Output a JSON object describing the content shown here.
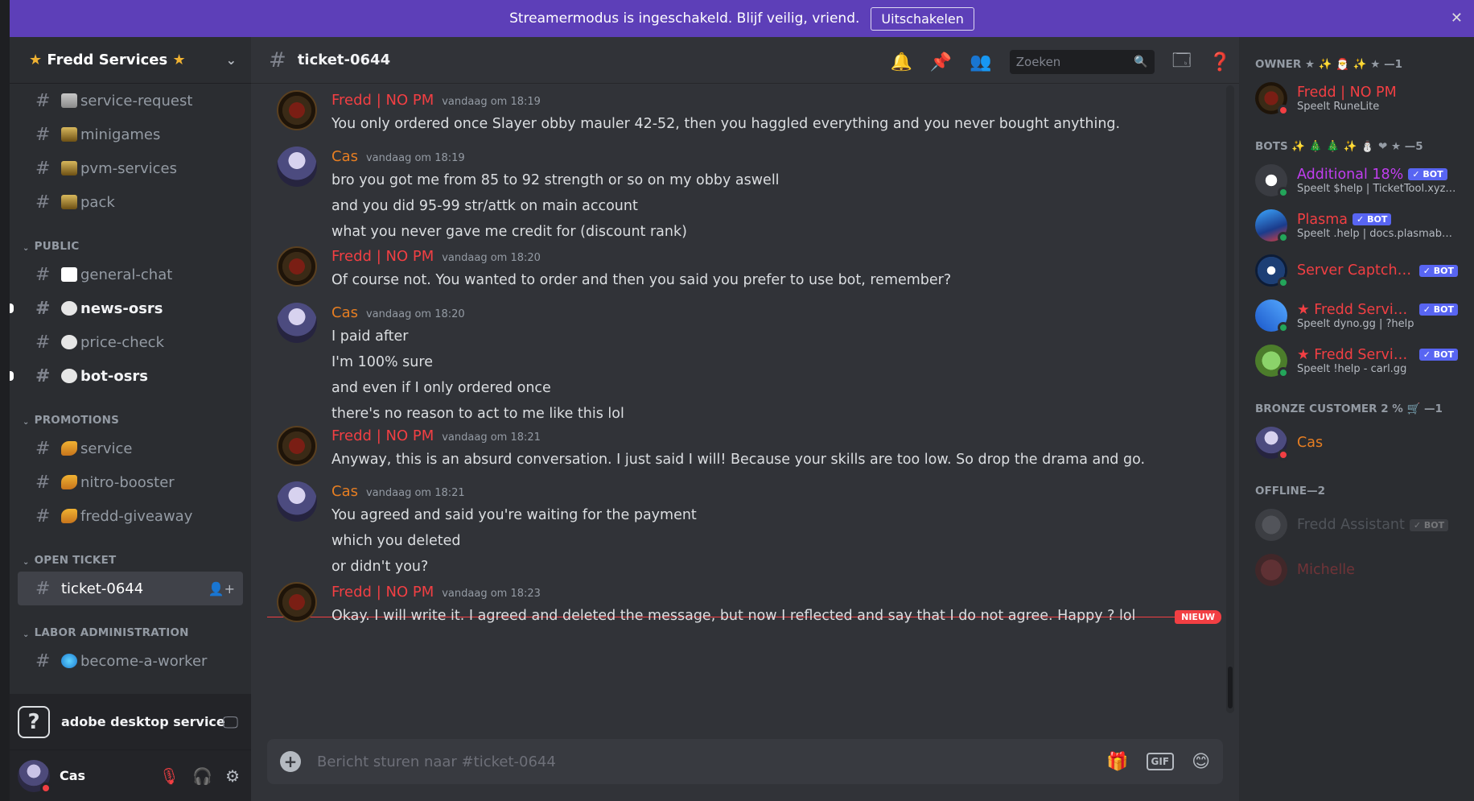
{
  "banner": {
    "text": "Streamermodus is ingeschakeld. Blijf veilig, vriend.",
    "button": "Uitschakelen"
  },
  "server": {
    "name": "Fredd Services"
  },
  "sidebar": {
    "items": [
      {
        "type": "channel",
        "label": "service-request",
        "emoji": "cart"
      },
      {
        "type": "channel",
        "label": "minigames",
        "emoji": "chest"
      },
      {
        "type": "channel",
        "label": "pvm-services",
        "emoji": "chest"
      },
      {
        "type": "channel",
        "label": "pack",
        "emoji": "chest"
      },
      {
        "type": "category",
        "label": "PUBLIC"
      },
      {
        "type": "channel",
        "label": "general-chat",
        "emoji": "speech"
      },
      {
        "type": "channel",
        "label": "news-osrs",
        "emoji": "circle",
        "unread": true
      },
      {
        "type": "channel",
        "label": "price-check",
        "emoji": "circle"
      },
      {
        "type": "channel",
        "label": "bot-osrs",
        "emoji": "circle",
        "unread": true
      },
      {
        "type": "category",
        "label": "PROMOTIONS"
      },
      {
        "type": "channel",
        "label": "service",
        "emoji": "horn"
      },
      {
        "type": "channel",
        "label": "nitro-booster",
        "emoji": "horn"
      },
      {
        "type": "channel",
        "label": "fredd-giveaway",
        "emoji": "horn"
      },
      {
        "type": "category",
        "label": "OPEN TICKET"
      },
      {
        "type": "channel",
        "label": "ticket-0644",
        "active": true
      },
      {
        "type": "category",
        "label": "LABOR ADMINISTRATION"
      },
      {
        "type": "channel",
        "label": "become-a-worker",
        "emoji": "globe"
      }
    ],
    "voice_status": "adobe desktop service",
    "user": "Cas"
  },
  "channel": {
    "name": "ticket-0644",
    "search_placeholder": "Zoeken",
    "composer_placeholder": "Bericht sturen naar #ticket-0644",
    "gif_label": "GIF"
  },
  "messages": [
    {
      "author": "Fredd | NO PM",
      "color": "#f23f43",
      "avatar": "fredd",
      "time": "vandaag om 18:19",
      "lines": [
        "You only ordered once Slayer obby mauler 42-52, then you haggled everything and you never bought anything."
      ]
    },
    {
      "author": "Cas",
      "color": "#e67e22",
      "avatar": "cas",
      "time": "vandaag om 18:19",
      "lines": [
        "bro you got me from 85 to 92 strength or so on my obby aswell",
        "and you did 95-99 str/attk on main account",
        "what you never gave me credit for (discount rank)"
      ]
    },
    {
      "author": "Fredd | NO PM",
      "color": "#f23f43",
      "avatar": "fredd",
      "time": "vandaag om 18:20",
      "lines": [
        "Of course not. You wanted to order and then you said you prefer to use bot, remember?"
      ]
    },
    {
      "author": "Cas",
      "color": "#e67e22",
      "avatar": "cas",
      "time": "vandaag om 18:20",
      "lines": [
        "I paid after",
        "I'm 100% sure",
        "and even if I only ordered once",
        "there's no reason to act to me like this lol"
      ]
    },
    {
      "author": "Fredd | NO PM",
      "color": "#f23f43",
      "avatar": "fredd",
      "time": "vandaag om 18:21",
      "lines": [
        "Anyway, this is an absurd conversation. I just said I will! Because your skills are too low. So drop the drama and go."
      ]
    },
    {
      "author": "Cas",
      "color": "#e67e22",
      "avatar": "cas",
      "time": "vandaag om 18:21",
      "lines": [
        "You agreed and said you're waiting for the payment",
        "which you deleted",
        "or didn't you?"
      ]
    },
    {
      "author": "Fredd | NO PM",
      "color": "#f23f43",
      "avatar": "fredd",
      "time": "vandaag om 18:23",
      "lines": [
        "Okay. I will write it. I agreed and deleted the message, but now I reflected and say that I do not agree. Happy ? lol"
      ]
    }
  ],
  "new_divider": "NIEUW",
  "members": {
    "groups": [
      {
        "label": "OWNER ★ ✨ 🎅 ✨ ★ —1",
        "list": [
          {
            "name": "Fredd | NO PM",
            "color": "#f23f43",
            "activity": "Speelt RuneLite",
            "avatar": "fredd",
            "status": "dnd"
          }
        ]
      },
      {
        "label": "BOTS ✨ 🎄 🎄 ✨ ⛄ ❤ ★ —5",
        "list": [
          {
            "name": "Additional 18%",
            "color": "#c13ef0",
            "activity": "Speelt $help | TicketTool.xyz | ...",
            "avatar": "bot1",
            "status": "on",
            "bot": true
          },
          {
            "name": "Plasma",
            "color": "#f23f43",
            "activity": "Speelt .help | docs.plasmabot....",
            "avatar": "bot2",
            "status": "on",
            "bot": true
          },
          {
            "name": "Server Captcha ...",
            "color": "#f23f43",
            "activity": "",
            "avatar": "bot3",
            "status": "on",
            "bot": true
          },
          {
            "name": "★ Fredd Servic...",
            "color": "#f23f43",
            "activity": "Speelt dyno.gg | ?help",
            "avatar": "bot4",
            "status": "on",
            "bot": true
          },
          {
            "name": "★ Fredd Servic...",
            "color": "#f23f43",
            "activity": "Speelt !help - carl.gg",
            "avatar": "bot5",
            "status": "on",
            "bot": true
          }
        ]
      },
      {
        "label": "BRONZE CUSTOMER 2 % 🛒 —1",
        "list": [
          {
            "name": "Cas",
            "color": "#e67e22",
            "activity": "",
            "avatar": "cas",
            "status": "dnd"
          }
        ]
      },
      {
        "label": "OFFLINE—2",
        "list": [
          {
            "name": "Fredd Assistant",
            "color": "#949ba4",
            "activity": "",
            "avatar": "shield",
            "status": "off",
            "bot": true
          },
          {
            "name": "Michelle",
            "color": "#f23f43",
            "activity": "",
            "avatar": "heart",
            "status": "off"
          }
        ]
      }
    ],
    "bot_label": "✓ BOT"
  },
  "colors": {
    "accent": "#5d3fb8",
    "blurple": "#5865f2",
    "red": "#f23f43",
    "orange": "#e67e22"
  }
}
